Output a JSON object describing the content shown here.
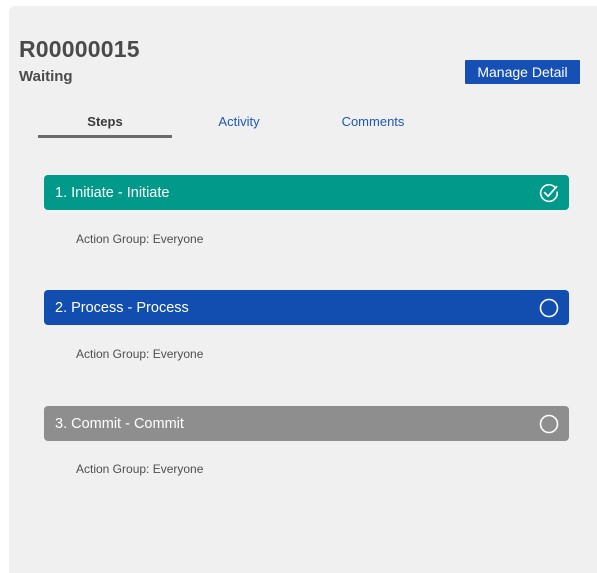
{
  "record": {
    "id": "R00000015",
    "status": "Waiting"
  },
  "toolbar": {
    "manage_label": "Manage Detail"
  },
  "tabs": [
    {
      "label": "Steps",
      "active": true
    },
    {
      "label": "Activity",
      "active": false
    },
    {
      "label": "Comments",
      "active": false
    }
  ],
  "steps": [
    {
      "label": "1. Initiate - Initiate",
      "action_group": "Action Group: Everyone",
      "color": "#00998a",
      "icon": "check-circle-icon",
      "completed": true
    },
    {
      "label": "2. Process - Process",
      "action_group": "Action Group: Everyone",
      "color": "#114eaf",
      "icon": "circle-icon",
      "completed": false
    },
    {
      "label": "3. Commit - Commit",
      "action_group": "Action Group: Everyone",
      "color": "#8e8e8e",
      "icon": "circle-icon",
      "completed": false
    }
  ]
}
